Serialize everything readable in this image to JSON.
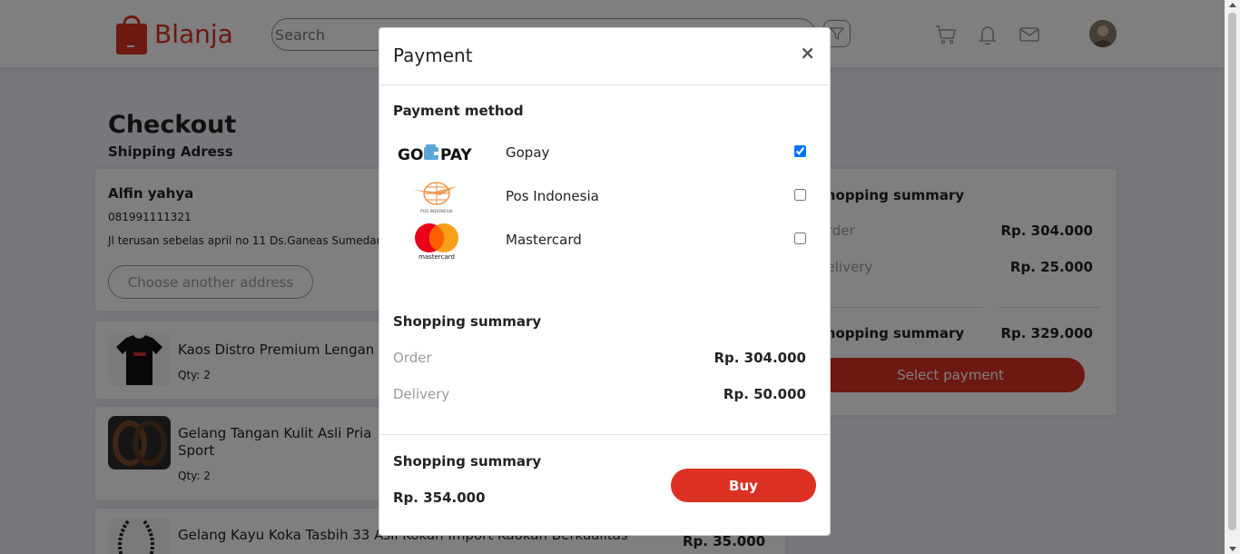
{
  "colors": {
    "brand": "#db3022",
    "muted": "#9b9b9b",
    "text": "#222222"
  },
  "nav": {
    "logo_text": "Blanja",
    "search_placeholder": "Search",
    "icons": [
      "filter-icon",
      "cart-icon",
      "bell-icon",
      "mail-icon"
    ]
  },
  "page": {
    "title": "Checkout",
    "subtitle": "Shipping Adress"
  },
  "address": {
    "name": "Alfin yahya",
    "phone": "081991111321",
    "line": "Jl terusan sebelas april no 11 Ds.Ganeas Sumedang",
    "button": "Choose another address"
  },
  "products": [
    {
      "name": "Kaos Distro Premium Lengan Pendek",
      "qty": "Qty: 2",
      "price": ""
    },
    {
      "name": "Gelang Tangan Kulit Asli Pria",
      "name2": "Sport",
      "qty": "Qty: 2",
      "price": ""
    },
    {
      "name": "Gelang Kayu Koka Tasbih 33 Asli Kokah Import Kaokah Berkualitas",
      "qty": "",
      "price": "Rp. 35.000"
    }
  ],
  "side_summary": {
    "title": "Shopping summary",
    "order_label": "Order",
    "order_value": "Rp. 304.000",
    "delivery_label": "Delivery",
    "delivery_value": "Rp. 25.000",
    "total_label": "Shopping summary",
    "total_value": "Rp. 329.000",
    "button": "Select payment"
  },
  "modal": {
    "title": "Payment",
    "close": "×",
    "method_heading": "Payment method",
    "methods": [
      {
        "name": "Gopay",
        "logo": "gopay-logo",
        "logo_text": "GO",
        "logo_text2": "PAY",
        "checked": true
      },
      {
        "name": "Pos Indonesia",
        "logo": "pos-indonesia-logo",
        "logo_text": "POS INDONESIA",
        "checked": false
      },
      {
        "name": "Mastercard",
        "logo": "mastercard-logo",
        "logo_text": "mastercard",
        "checked": false
      }
    ],
    "summary_heading": "Shopping summary",
    "order_label": "Order",
    "order_value": "Rp. 304.000",
    "delivery_label": "Delivery",
    "delivery_value": "Rp. 50.000",
    "footer_heading": "Shopping summary",
    "total_value": "Rp. 354.000",
    "buy_button": "Buy"
  }
}
